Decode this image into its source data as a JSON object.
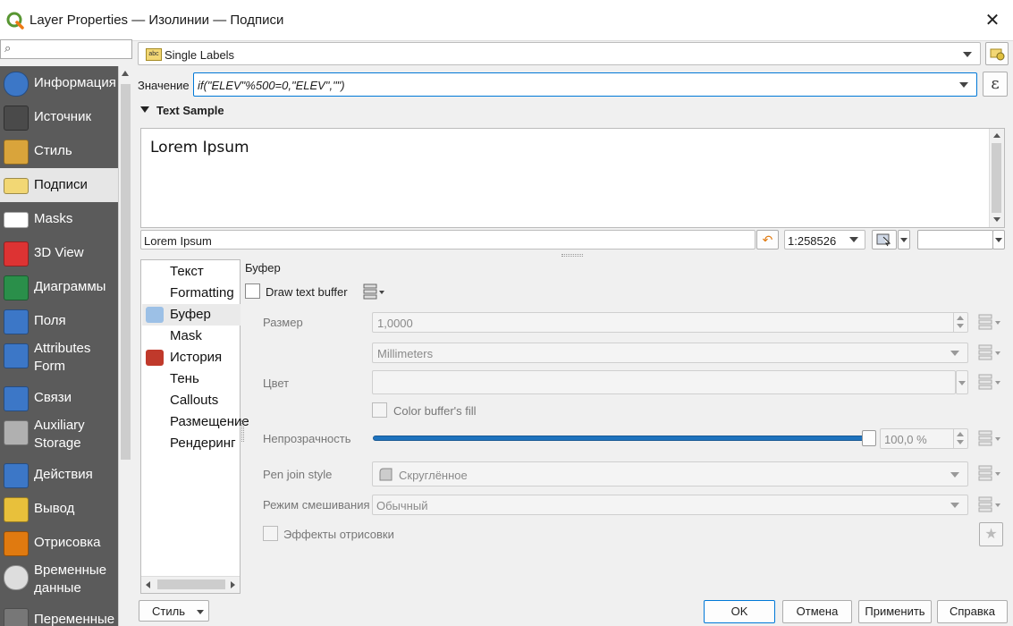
{
  "window": {
    "title": "Layer Properties — Изолинии — Подписи"
  },
  "sidebar": {
    "search_placeholder": "",
    "items": [
      {
        "label": "Информация",
        "icon": "info-icon"
      },
      {
        "label": "Источник",
        "icon": "source-icon"
      },
      {
        "label": "Стиль",
        "icon": "symbology-icon"
      },
      {
        "label": "Подписи",
        "icon": "labels-icon"
      },
      {
        "label": "Masks",
        "icon": "masks-icon"
      },
      {
        "label": "3D View",
        "icon": "3d-view-icon"
      },
      {
        "label": "Диаграммы",
        "icon": "diagrams-icon"
      },
      {
        "label": "Поля",
        "icon": "fields-icon"
      },
      {
        "label": "Attributes Form",
        "icon": "attributes-form-icon"
      },
      {
        "label": "Связи",
        "icon": "joins-icon"
      },
      {
        "label": "Auxiliary Storage",
        "icon": "auxiliary-storage-icon"
      },
      {
        "label": "Действия",
        "icon": "actions-icon"
      },
      {
        "label": "Вывод",
        "icon": "display-icon"
      },
      {
        "label": "Отрисовка",
        "icon": "rendering-icon"
      },
      {
        "label": "Временные данные",
        "icon": "temporal-icon"
      },
      {
        "label": "Переменные",
        "icon": "variables-icon"
      }
    ]
  },
  "label_mode": {
    "value": "Single Labels"
  },
  "value_row": {
    "label": "Значение",
    "expression": "if(\"ELEV\"%500=0,\"ELEV\",\"\")"
  },
  "text_sample": {
    "header": "Text Sample",
    "preview_text": "Lorem Ipsum",
    "input_value": "Lorem Ipsum",
    "scale": "1:258526"
  },
  "tabs": [
    {
      "label": "Текст",
      "icon": "text-icon"
    },
    {
      "label": "Formatting",
      "icon": "formatting-icon"
    },
    {
      "label": "Буфер",
      "icon": "buffer-icon"
    },
    {
      "label": "Mask",
      "icon": "mask-icon"
    },
    {
      "label": "История",
      "icon": "background-icon"
    },
    {
      "label": "Тень",
      "icon": "shadow-icon"
    },
    {
      "label": "Callouts",
      "icon": "callouts-icon"
    },
    {
      "label": "Размещение",
      "icon": "placement-icon"
    },
    {
      "label": "Рендеринг",
      "icon": "rendering-tab-icon"
    }
  ],
  "buffer": {
    "section_title": "Буфер",
    "draw_label": "Draw text buffer",
    "size_label": "Размер",
    "size_value": "1,0000",
    "units_value": "Millimeters",
    "color_label": "Цвет",
    "color_fill_label": "Color buffer's fill",
    "opacity_label": "Непрозрачность",
    "opacity_value": "100,0 %",
    "opacity_fraction": 1.0,
    "pen_join_label": "Pen join style",
    "pen_join_value": "Скруглённое",
    "blend_label": "Режим смешивания",
    "blend_value": "Обычный",
    "effects_label": "Эффекты отрисовки"
  },
  "footer": {
    "style_label": "Стиль",
    "ok": "OK",
    "cancel": "Отмена",
    "apply": "Применить",
    "help": "Справка"
  },
  "colors": {
    "sidebar_bg": "#5b5b5b",
    "accent": "#0078d7",
    "slider": "#1e73be"
  }
}
